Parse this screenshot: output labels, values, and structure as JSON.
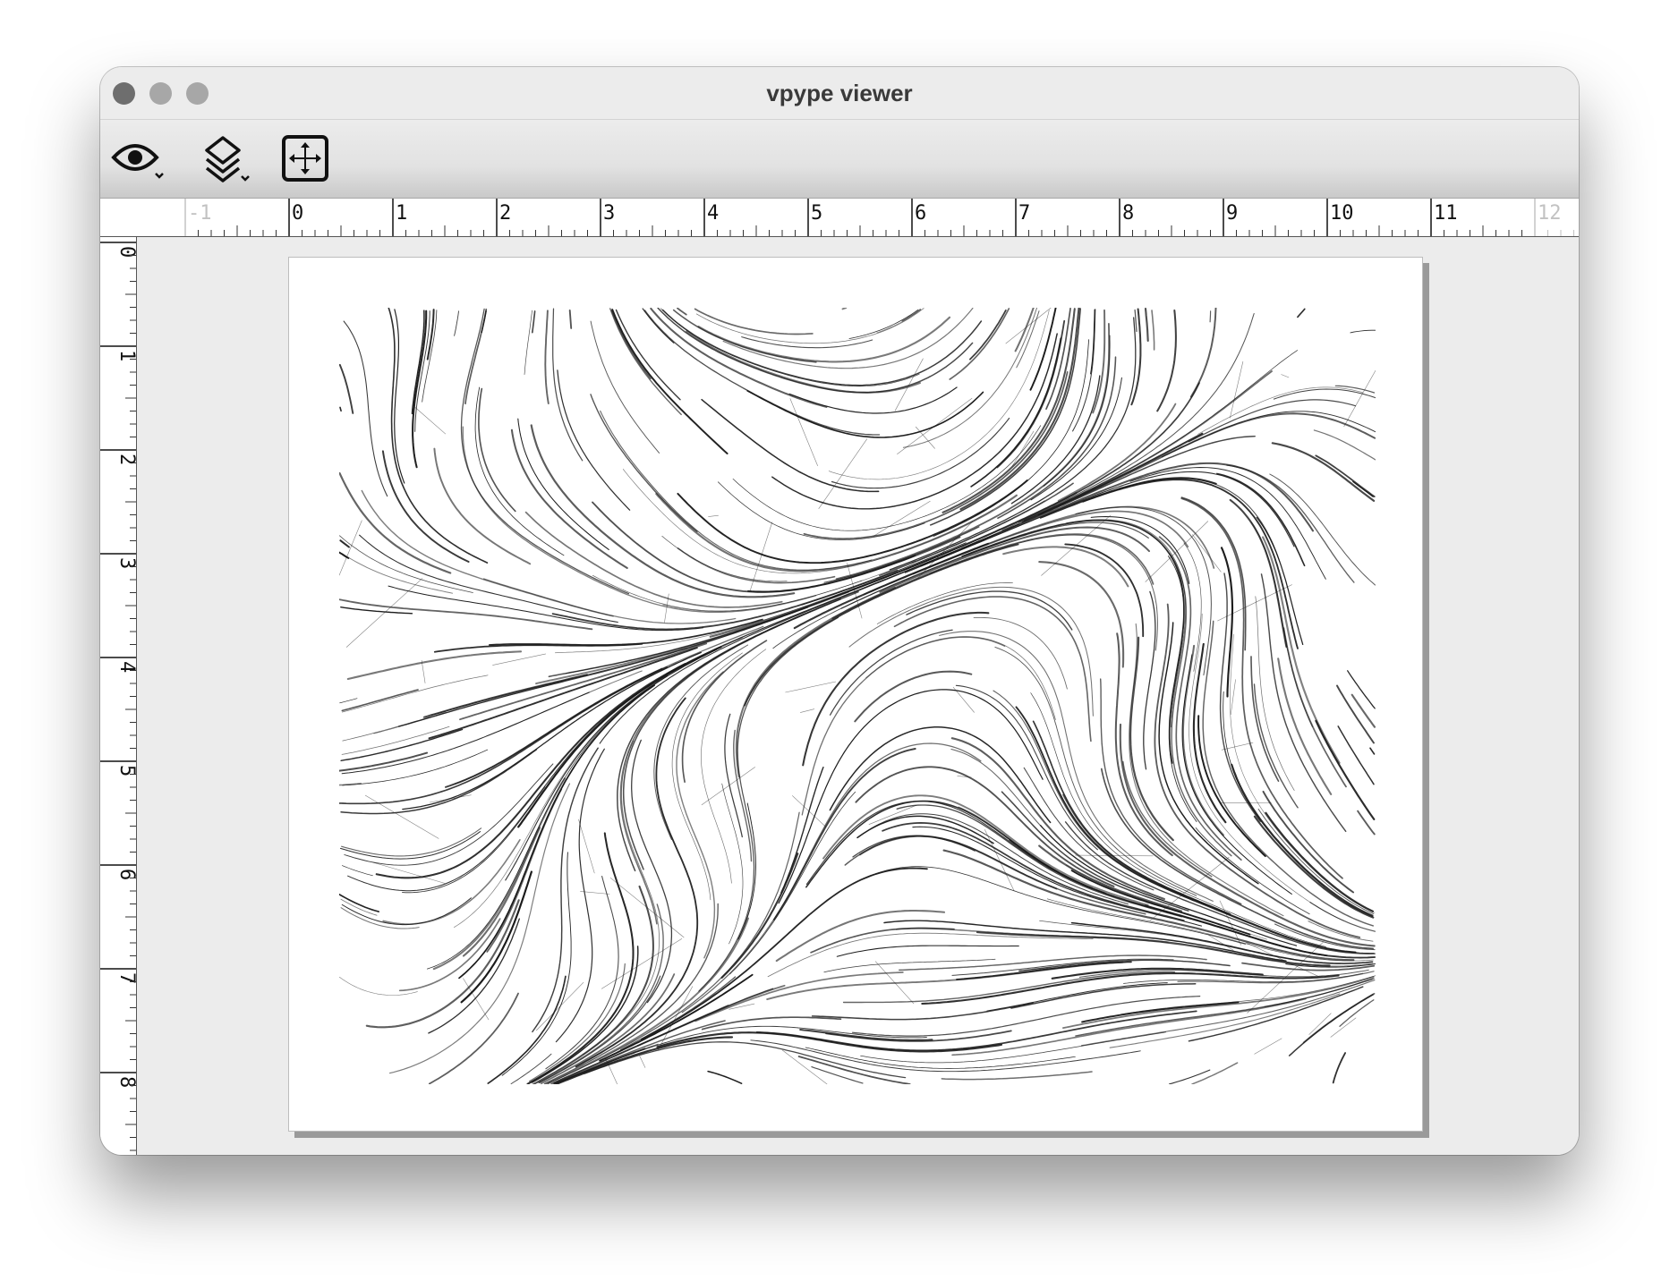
{
  "window": {
    "title": "vpype viewer",
    "traffic_lights": [
      "#6e6e6e",
      "#a7a7a7",
      "#a7a7a7"
    ]
  },
  "toolbar": {
    "buttons": [
      {
        "icon": "eye-icon",
        "menu_indicator": true
      },
      {
        "icon": "layers-icon",
        "menu_indicator": true
      },
      {
        "icon": "fit-to-page-icon",
        "menu_indicator": false
      }
    ]
  },
  "ruler": {
    "unit": "in",
    "horizontal_labels": [
      "-1",
      "0",
      "1",
      "2",
      "3",
      "4",
      "5",
      "6",
      "7",
      "8",
      "9",
      "10",
      "11",
      "12"
    ],
    "dimmed_horizontal_labels": [
      "-1",
      "12"
    ],
    "vertical_labels": [
      "0",
      "1",
      "2",
      "3",
      "4",
      "5",
      "6",
      "7",
      "8"
    ]
  },
  "colors": {
    "stroke": "#1a1a1a",
    "page": "#ffffff",
    "canvas": "#ececec"
  }
}
